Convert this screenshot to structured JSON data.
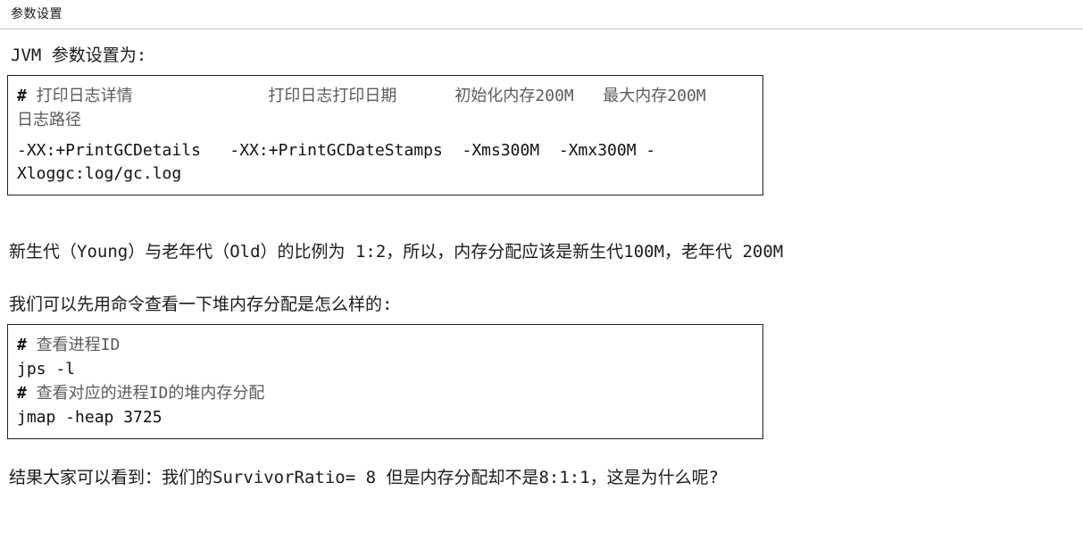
{
  "header": {
    "title": "参数设置"
  },
  "sections": {
    "intro": "JVM 参数设置为:",
    "ratio_note": "新生代（Young）与老年代（Old）的比例为 1:2，所以，内存分配应该是新生代100M，老年代 200M",
    "cmd_lead": "我们可以先用命令查看一下堆内存分配是怎么样的:",
    "result_note": "结果大家可以看到：我们的SurvivorRatio= 8 但是内存分配却不是8:1:1，这是为什么呢?"
  },
  "code_blocks": [
    {
      "name": "jvm-params",
      "lines": [
        {
          "type": "comment",
          "hash": "#",
          "text": " 打印日志详情              打印日志打印日期      初始化内存200M   最大内存200M     日志路径"
        },
        {
          "type": "code",
          "text": "-XX:+PrintGCDetails   -XX:+PrintGCDateStamps  -Xms300M  -Xmx300M -Xloggc:log/gc.log"
        }
      ]
    },
    {
      "name": "jmap-commands",
      "lines": [
        {
          "type": "comment",
          "hash": "#",
          "text": " 查看进程ID"
        },
        {
          "type": "code",
          "text": "jps -l"
        },
        {
          "type": "comment",
          "hash": "#",
          "text": " 查看对应的进程ID的堆内存分配"
        },
        {
          "type": "code",
          "text": "jmap -heap 3725"
        }
      ]
    }
  ],
  "colors": {
    "header_border": "#c8c8c8",
    "code_border": "#222222",
    "comment_text": "#5b5b5b",
    "body_text": "#1b1b1b",
    "background": "#ffffff"
  }
}
